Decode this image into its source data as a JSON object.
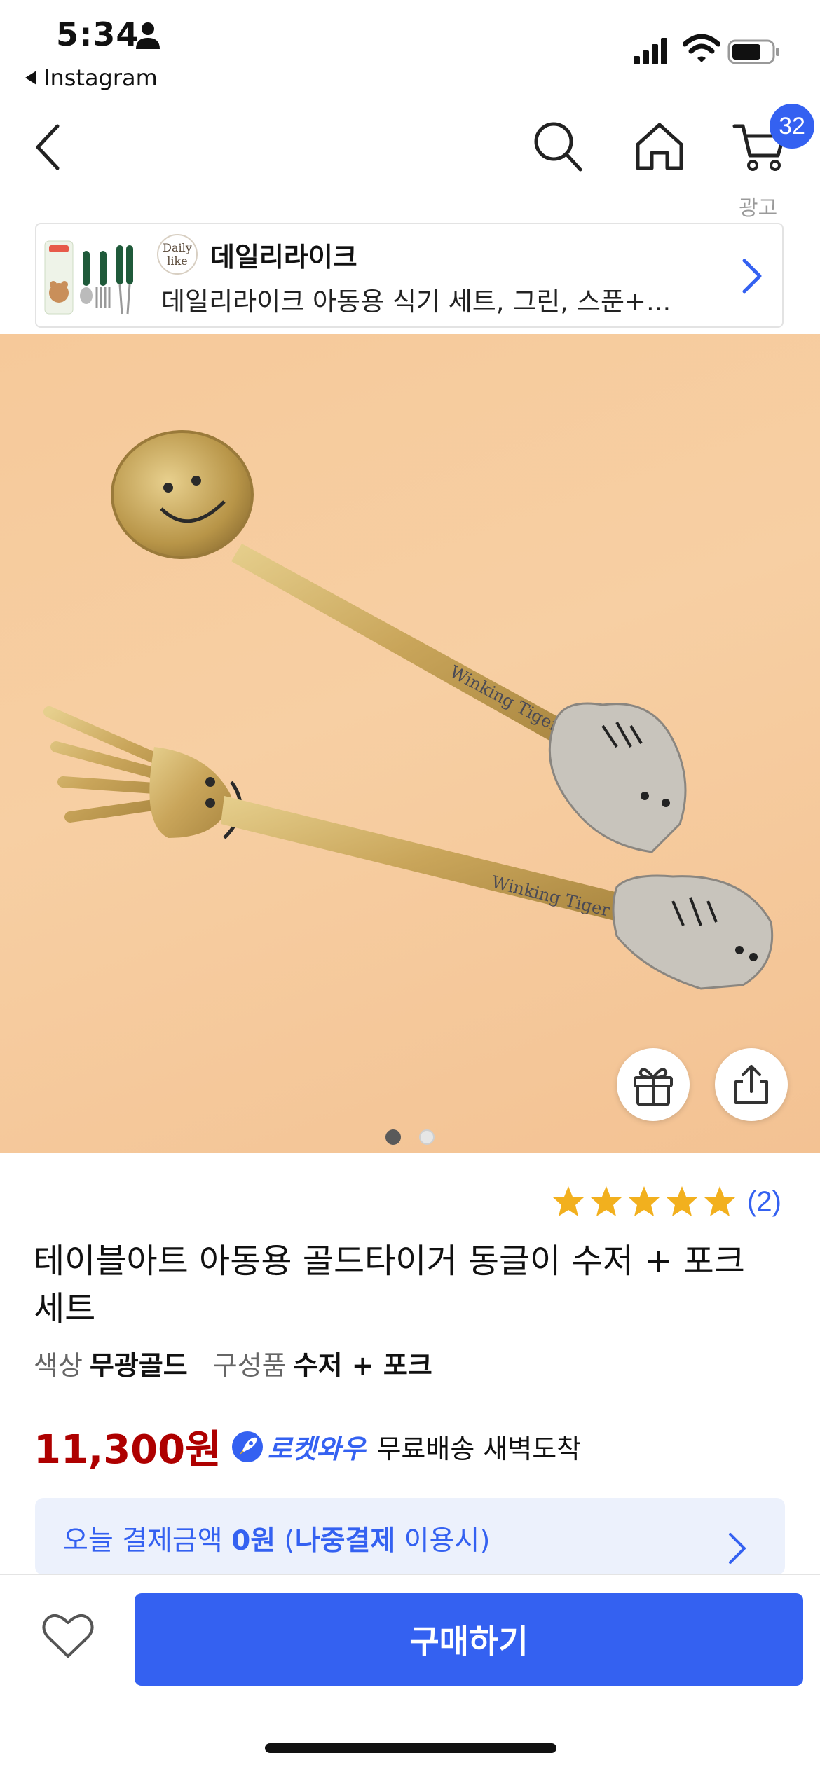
{
  "status_bar": {
    "time": "5:34",
    "back_app": "Instagram"
  },
  "nav": {
    "cart_count": "32",
    "ad_label": "광고",
    "icons": [
      "back-icon",
      "search-icon",
      "home-icon",
      "cart-icon"
    ]
  },
  "ad_banner": {
    "logo_text_1": "Daily",
    "logo_text_2": "like",
    "brand": "데일리라이크",
    "product": "데일리라이크 아동용 식기 세트, 그린, 스푼+..."
  },
  "product_image": {
    "engraving_1": "Winking Tiger",
    "engraving_2": "Winking Tiger",
    "page_dots": 2,
    "active_dot": 1
  },
  "rating": {
    "stars": 5,
    "count": "(2)"
  },
  "title": "테이블아트 아동용 골드타이거 동글이 수저 + 포크 세트",
  "options": [
    {
      "label": "색상",
      "value": "무광골드"
    },
    {
      "label": "구성품",
      "value": "수저 + 포크"
    }
  ],
  "price": {
    "amount": "11,300원",
    "rocket_label": "로켓와우",
    "delivery": "무료배송 새벽도착"
  },
  "pay_banner": {
    "pre": "오늘 결제금액 ",
    "amount": "0원",
    "mid": " (",
    "method": "나중결제",
    "post": " 이용시)"
  },
  "bottom_bar": {
    "buy_label": "구매하기"
  },
  "colors": {
    "accent": "#3461f1",
    "price": "#ae0000",
    "pay_bg": "#ecf1fc",
    "star": "#f2b01e"
  }
}
